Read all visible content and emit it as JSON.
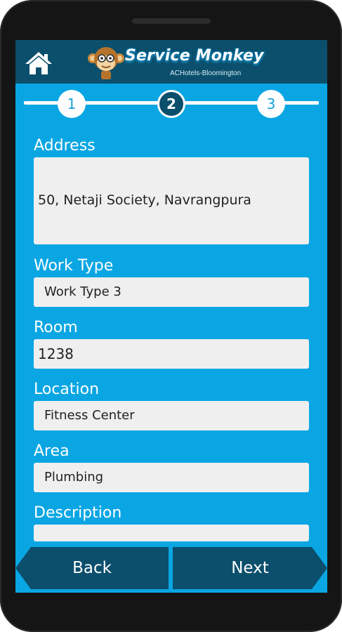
{
  "header": {
    "app_name": "Service Monkey",
    "hotel": "ACHotels-Bloomington"
  },
  "stepper": {
    "steps": [
      "1",
      "2",
      "3"
    ],
    "current": 2
  },
  "form": {
    "address": {
      "label": "Address",
      "value": "50, Netaji Society, Navrangpura"
    },
    "work_type": {
      "label": "Work Type",
      "value": "Work Type 3"
    },
    "room": {
      "label": "Room",
      "value": "1238"
    },
    "location": {
      "label": "Location",
      "value": "Fitness Center"
    },
    "area": {
      "label": "Area",
      "value": "Plumbing"
    },
    "description": {
      "label": "Description",
      "value": ""
    }
  },
  "nav": {
    "back_label": "Back",
    "next_label": "Next"
  },
  "colors": {
    "screen_bg": "#0aa6e3",
    "bar_dark": "#0b4f6c",
    "field_bg": "#efefef"
  },
  "icons": {
    "home": "home-icon",
    "logo": "monkey-logo-icon"
  }
}
